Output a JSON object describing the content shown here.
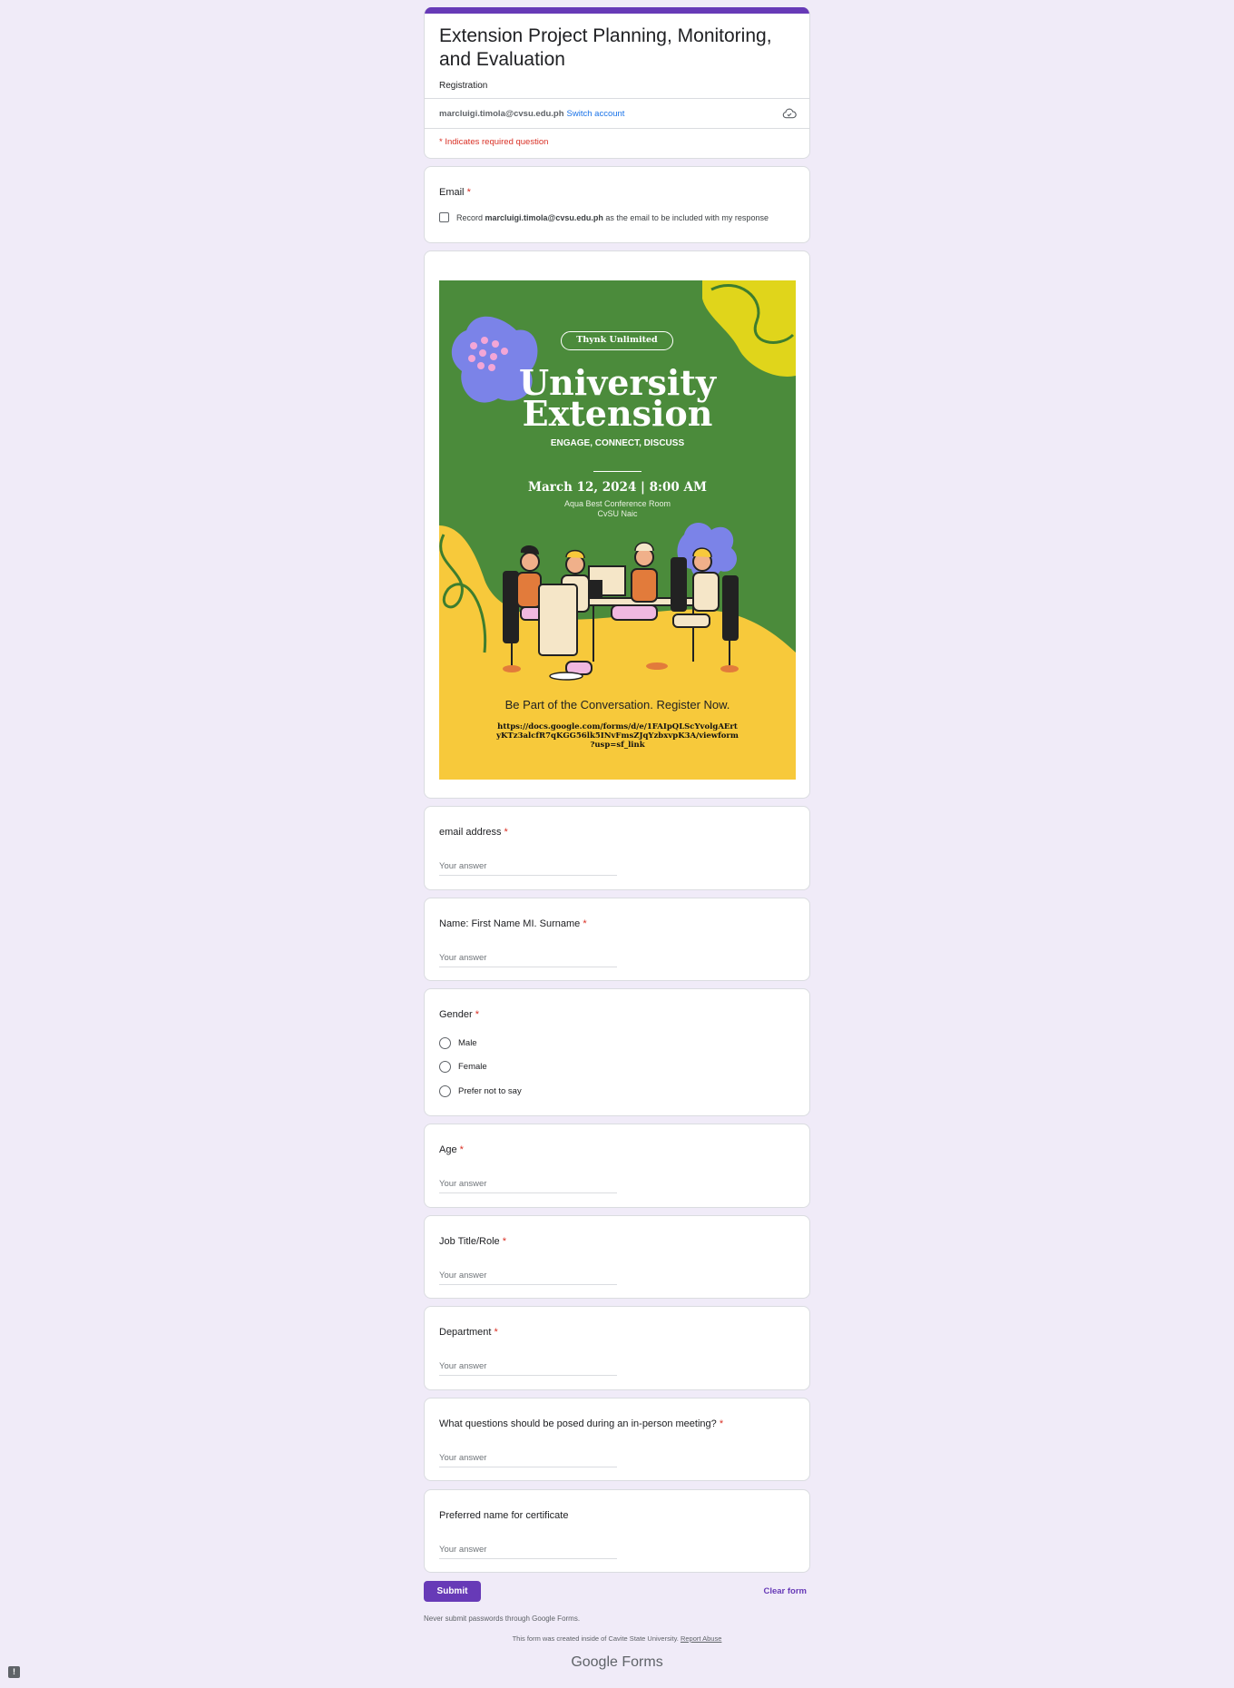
{
  "header": {
    "title": "Extension Project Planning, Monitoring, and Evaluation",
    "description": "Registration",
    "account_email": "marcluigi.timola@cvsu.edu.ph",
    "switch_account": "Switch account",
    "required_note": "* Indicates required question"
  },
  "email_question": {
    "label": "Email",
    "checkbox_prefix": "Record",
    "checkbox_email": "marcluigi.timola@cvsu.edu.ph",
    "checkbox_suffix": "as the email to be included with my response"
  },
  "poster": {
    "badge": "Thynk Unlimited",
    "title_line1": "University",
    "title_line2": "Extension",
    "tagline": "ENGAGE, CONNECT, DISCUSS",
    "datetime": "March 12, 2024 | 8:00 AM",
    "venue_line1": "Aqua Best  Conference Room",
    "venue_line2": "CvSU Naic",
    "cta": "Be Part of the Conversation. Register Now.",
    "link_line1": "https://docs.google.com/forms/d/e/1FAIpQLScYvolgAErt",
    "link_line2": "yKTz3alcfR7qKGG56lk5INvFmsZJqYzbxvpK3A/viewform",
    "link_line3": "?usp=sf_link"
  },
  "questions": [
    {
      "label": "email address",
      "required": "*",
      "placeholder": "Your answer"
    },
    {
      "label": "Name: First Name MI. Surname",
      "required": "*",
      "placeholder": "Your answer"
    },
    {
      "label": "Gender",
      "required": "*",
      "options": [
        "Male",
        "Female",
        "Prefer not to say"
      ]
    },
    {
      "label": "Age",
      "required": "*",
      "placeholder": "Your answer"
    },
    {
      "label": "Job Title/Role",
      "required": "*",
      "placeholder": "Your answer"
    },
    {
      "label": "Department",
      "required": "*",
      "placeholder": "Your answer"
    },
    {
      "label": "What questions should be posed during an in-person meeting?",
      "required": "*",
      "placeholder": "Your answer"
    },
    {
      "label": "Preferred name for certificate",
      "required": "",
      "placeholder": "Your answer"
    }
  ],
  "actions": {
    "submit": "Submit",
    "clear": "Clear form",
    "password_note": "Never submit passwords through Google Forms."
  },
  "footer": {
    "created_text": "This form was created inside of Cavite State University.",
    "report_abuse": "Report Abuse",
    "brand_google": "Google",
    "brand_forms": "Forms"
  },
  "colors": {
    "accent": "#673ab7",
    "background": "#f0ebf8",
    "required": "#d93025",
    "poster_green": "#4b8b3b",
    "poster_yellow": "#f7c93b",
    "poster_purple": "#7b83e8"
  }
}
